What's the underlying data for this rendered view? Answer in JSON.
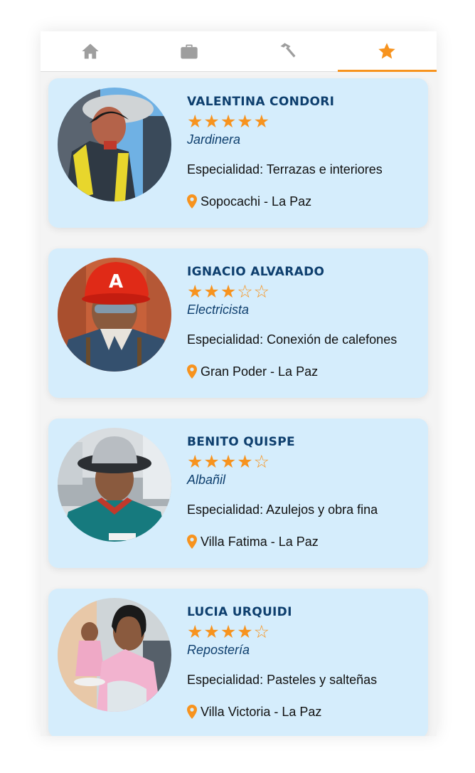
{
  "tabs": [
    {
      "id": "home",
      "icon": "home-icon",
      "active": false
    },
    {
      "id": "jobs",
      "icon": "briefcase-icon",
      "active": false
    },
    {
      "id": "tools",
      "icon": "hammer-icon",
      "active": false
    },
    {
      "id": "favorites",
      "icon": "star-icon",
      "active": true
    }
  ],
  "colors": {
    "accent": "#f7931e",
    "card_bg": "#d5edfc",
    "name_text": "#0e3f6e",
    "tab_icon_inactive": "#9e9e9e"
  },
  "workers": [
    {
      "name": "VALENTINA CONDORI",
      "rating": 5,
      "stars": "★★★★★",
      "role": "Jardinera",
      "specialty": "Especialidad: Terrazas e interiores",
      "location": "Sopocachi - La Paz"
    },
    {
      "name": "IGNACIO ALVARADO",
      "rating": 3,
      "stars": "★★★☆☆",
      "role": "Electricista",
      "specialty": "Especialidad: Conexión de calefones",
      "location": "Gran Poder - La Paz"
    },
    {
      "name": "BENITO QUISPE",
      "rating": 4,
      "stars": "★★★★☆",
      "role": "Albañil",
      "specialty": "Especialidad: Azulejos y obra fina",
      "location": "Villa Fatima - La Paz"
    },
    {
      "name": "LUCIA URQUIDI",
      "rating": 4,
      "stars": "★★★★☆",
      "role": "Repostería",
      "specialty": "Especialidad: Pasteles y salteñas",
      "location": "Villa Victoria - La Paz"
    }
  ]
}
